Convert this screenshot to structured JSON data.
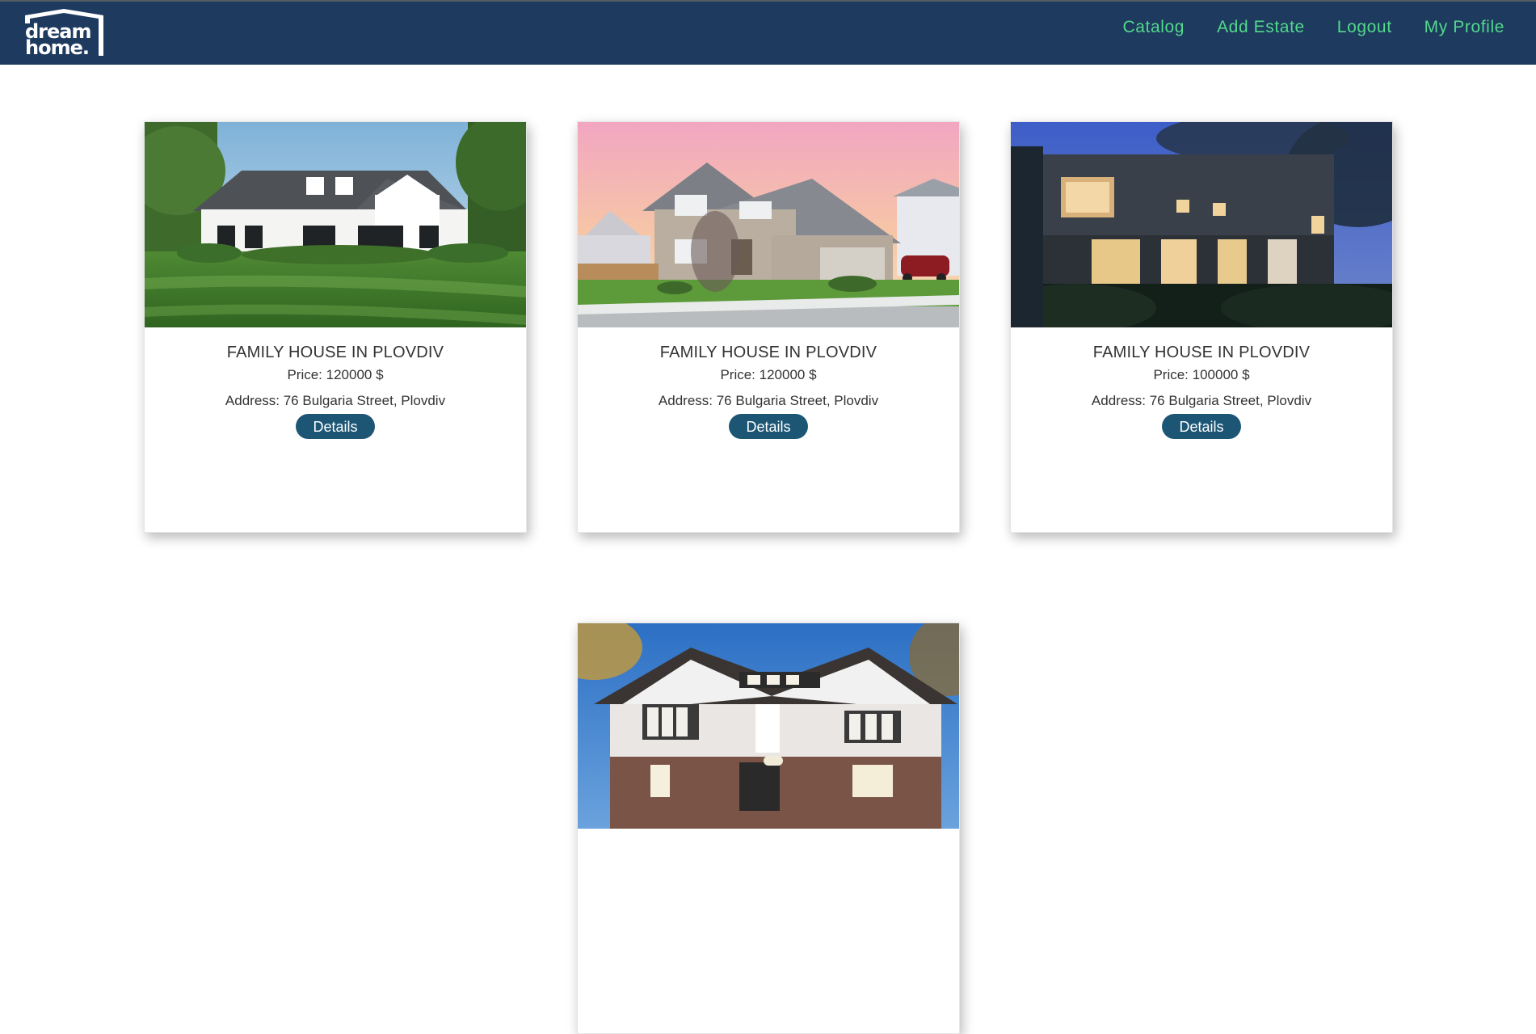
{
  "brand": {
    "logo_line1": "dream",
    "logo_line2": "home."
  },
  "nav": {
    "items": [
      {
        "label": "Catalog"
      },
      {
        "label": "Add Estate"
      },
      {
        "label": "Logout"
      },
      {
        "label": "My Profile"
      }
    ]
  },
  "colors": {
    "header_bg": "#1e3a5f",
    "nav_link": "#52d98b",
    "button_bg": "#1d5675"
  },
  "catalog": {
    "estates": [
      {
        "title": "FAMILY HOUSE IN PLOVDIV",
        "price": "Price: 120000 $",
        "address": "Address: 76 Bulgaria Street, Plovdiv",
        "button": "Details",
        "image": "white-farmhouse-photo"
      },
      {
        "title": "FAMILY HOUSE IN PLOVDIV",
        "price": "Price: 120000 $",
        "address": "Address: 76 Bulgaria Street, Plovdiv",
        "button": "Details",
        "image": "two-story-suburban-house-photo"
      },
      {
        "title": "FAMILY HOUSE IN PLOVDIV",
        "price": "Price: 100000 $",
        "address": "Address: 76 Bulgaria Street, Plovdiv",
        "button": "Details",
        "image": "modern-dark-house-night-photo"
      },
      {
        "image": "modern-villa-dusk-photo"
      }
    ]
  }
}
